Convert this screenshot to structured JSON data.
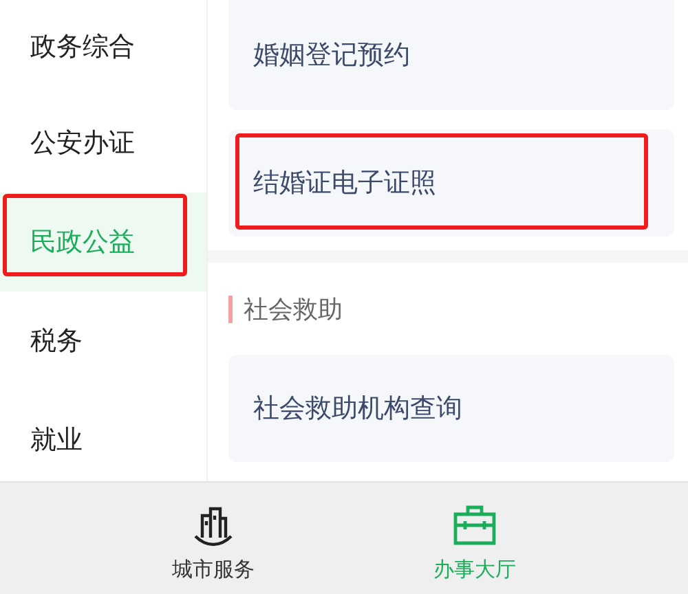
{
  "sidebar": {
    "items": [
      {
        "label": "政务综合",
        "selected": false,
        "highlighted": false
      },
      {
        "label": "公安办证",
        "selected": false,
        "highlighted": false
      },
      {
        "label": "民政公益",
        "selected": true,
        "highlighted": true
      },
      {
        "label": "税务",
        "selected": false,
        "highlighted": false
      },
      {
        "label": "就业",
        "selected": false,
        "highlighted": false
      }
    ]
  },
  "content": {
    "blocks": [
      {
        "kind": "card",
        "label": "婚姻登记预约",
        "highlighted": false
      },
      {
        "kind": "card",
        "label": "结婚证电子证照",
        "highlighted": true
      },
      {
        "kind": "divider"
      },
      {
        "kind": "section",
        "label": "社会救助"
      },
      {
        "kind": "card",
        "label": "社会救助机构查询",
        "highlighted": false
      }
    ]
  },
  "tab_bar": {
    "tabs": [
      {
        "label": "城市服务",
        "kind": "city",
        "selected": false
      },
      {
        "label": "办事大厅",
        "kind": "briefcase",
        "selected": true
      }
    ]
  }
}
